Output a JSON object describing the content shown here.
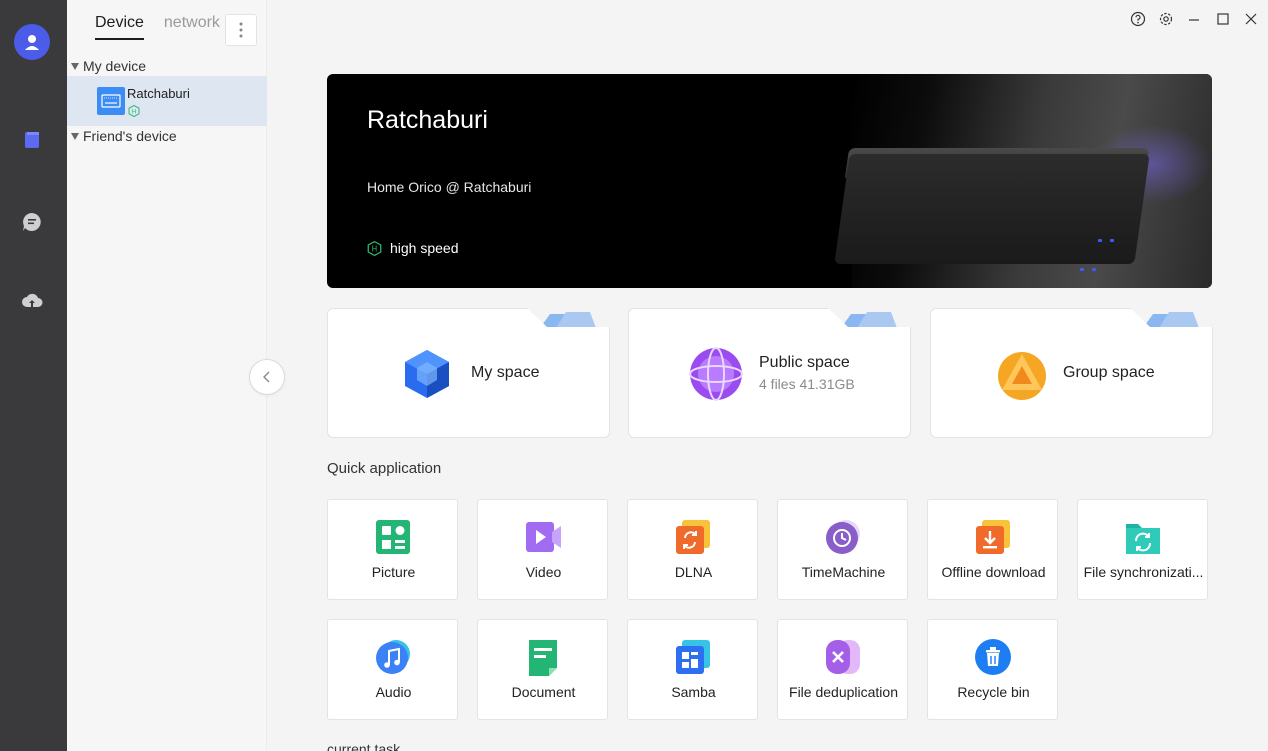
{
  "sidebar_rail": {
    "icons": [
      "user-icon",
      "device-icon",
      "chat-icon",
      "cloud-upload-icon"
    ],
    "accent": "#4b5ce8"
  },
  "tree": {
    "tabs": [
      {
        "label": "Device",
        "active": true
      },
      {
        "label": "network",
        "active": false
      }
    ],
    "groups": [
      {
        "label": "My device"
      },
      {
        "label": "Friend's device"
      }
    ],
    "device": {
      "name": "Ratchaburi",
      "badge": "H"
    }
  },
  "banner": {
    "title": "Ratchaburi",
    "subtitle": "Home Orico @ Ratchaburi",
    "speed_label": "high speed",
    "speed_icon": "H"
  },
  "spaces": [
    {
      "title": "My space",
      "meta": "",
      "color": "#2a6cf0"
    },
    {
      "title": "Public space",
      "meta": "4 files 41.31GB",
      "color": "#9b4cf0"
    },
    {
      "title": "Group space",
      "meta": "",
      "color": "#f5a623"
    }
  ],
  "quick_app": {
    "title": "Quick application",
    "apps": [
      {
        "label": "Picture",
        "icon": "picture-icon"
      },
      {
        "label": "Video",
        "icon": "video-icon"
      },
      {
        "label": "DLNA",
        "icon": "dlna-icon"
      },
      {
        "label": "TimeMachine",
        "icon": "timemachine-icon"
      },
      {
        "label": "Offline download",
        "icon": "offline-download-icon"
      },
      {
        "label": "File synchronizati...",
        "icon": "file-sync-icon"
      },
      {
        "label": "Audio",
        "icon": "audio-icon"
      },
      {
        "label": "Document",
        "icon": "document-icon"
      },
      {
        "label": "Samba",
        "icon": "samba-icon"
      },
      {
        "label": "File deduplication",
        "icon": "file-dedup-icon"
      },
      {
        "label": "Recycle bin",
        "icon": "recycle-bin-icon"
      }
    ]
  },
  "current_task": {
    "title": "current task"
  }
}
